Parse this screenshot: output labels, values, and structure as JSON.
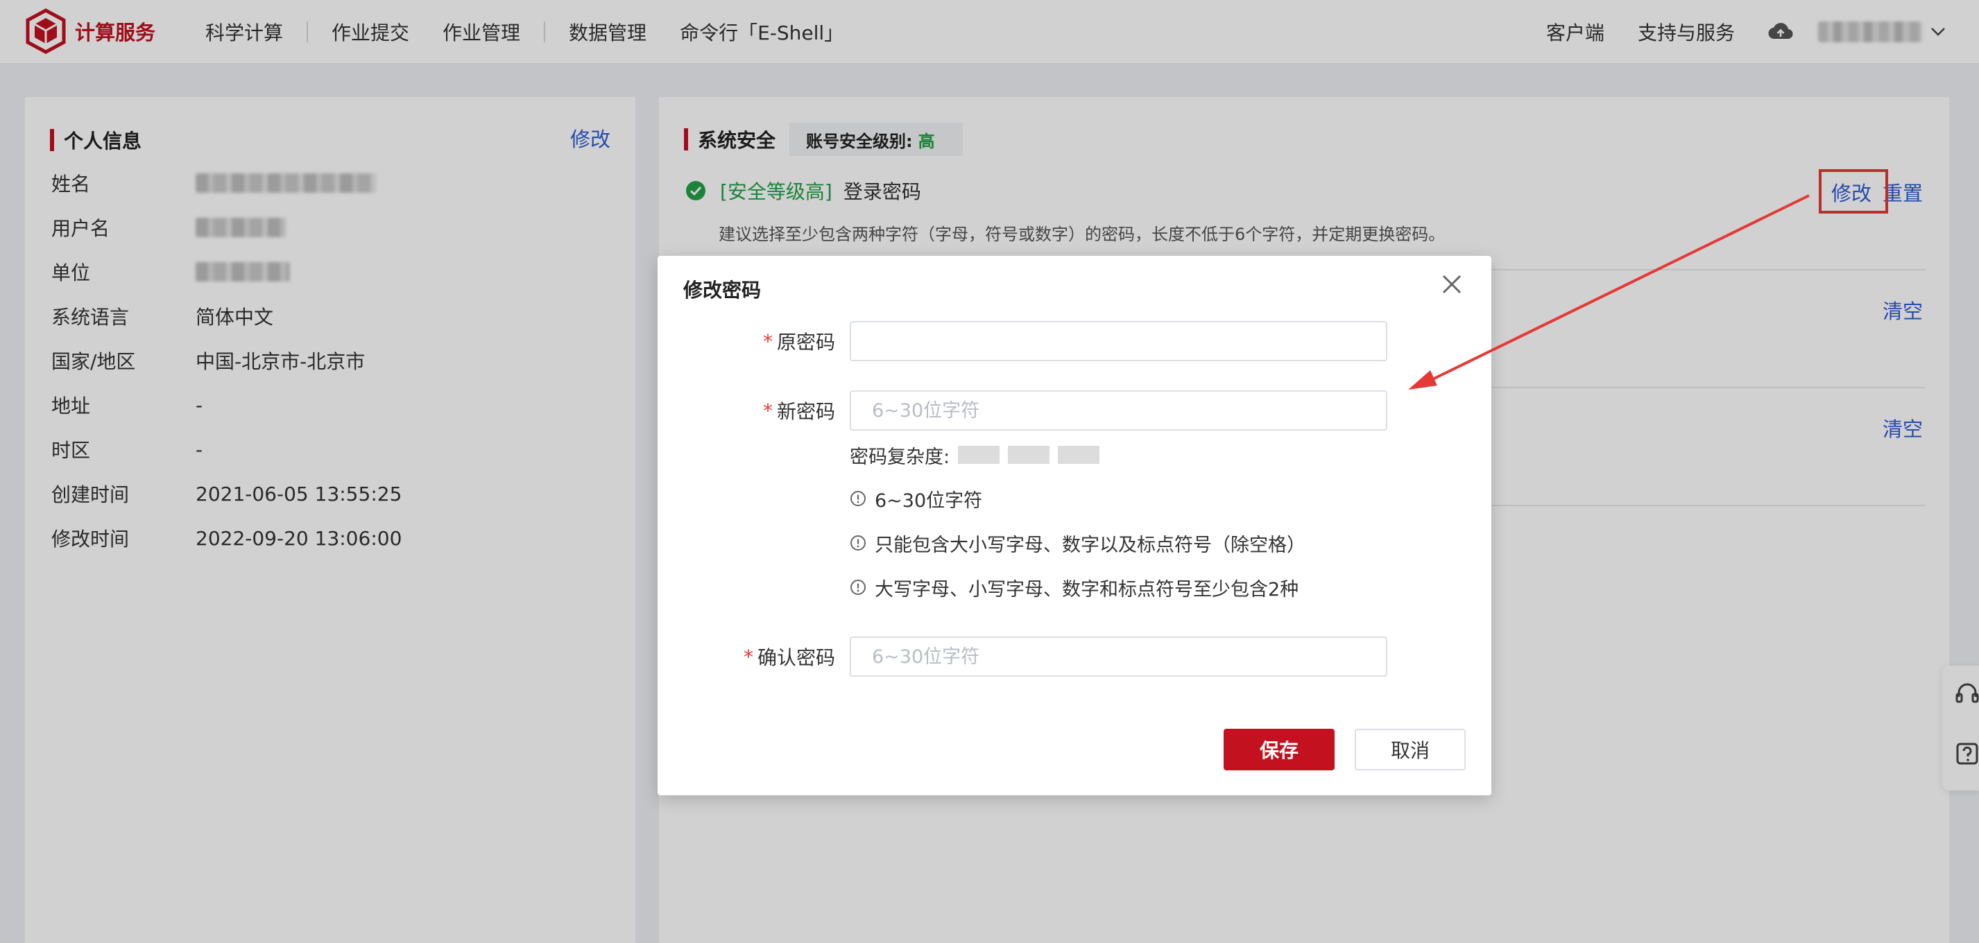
{
  "header": {
    "logo_text": "计算服务",
    "nav": [
      "科学计算",
      "作业提交",
      "作业管理",
      "数据管理",
      "命令行「E-Shell」"
    ],
    "right": [
      "客户端",
      "支持与服务"
    ]
  },
  "profile": {
    "title": "个人信息",
    "edit_label": "修改",
    "rows": [
      {
        "label": "姓名",
        "value": ""
      },
      {
        "label": "用户名",
        "value": ""
      },
      {
        "label": "单位",
        "value": ""
      },
      {
        "label": "系统语言",
        "value": "简体中文"
      },
      {
        "label": "国家/地区",
        "value": "中国-北京市-北京市"
      },
      {
        "label": "地址",
        "value": "-"
      },
      {
        "label": "时区",
        "value": "-"
      },
      {
        "label": "创建时间",
        "value": "2021-06-05 13:55:25"
      },
      {
        "label": "修改时间",
        "value": "2022-09-20 13:06:00"
      }
    ]
  },
  "security": {
    "title": "系统安全",
    "level_label": "账号安全级别:",
    "level_value": "高",
    "password_level": "[安全等级高]",
    "password_label": "登录密码",
    "password_hint": "建议选择至少包含两种字符（字母，符号或数字）的密码，长度不低于6个字符，并定期更换密码。",
    "modify_label": "修改",
    "reset_label": "重置",
    "clear_label_1": "清空",
    "clear_label_2": "清空"
  },
  "modal": {
    "title": "修改密码",
    "old_password_label": "原密码",
    "new_password_label": "新密码",
    "new_password_placeholder": "6~30位字符",
    "complexity_label": "密码复杂度:",
    "rules": [
      "6~30位字符",
      "只能包含大小写字母、数字以及标点符号（除空格）",
      "大写字母、小写字母、数字和标点符号至少包含2种"
    ],
    "confirm_password_label": "确认密码",
    "confirm_password_placeholder": "6~30位字符",
    "save_label": "保存",
    "cancel_label": "取消"
  },
  "colors": {
    "brand": "#c4111f",
    "link": "#2f5bd3",
    "success": "#23a047",
    "annotation": "#e53935"
  }
}
